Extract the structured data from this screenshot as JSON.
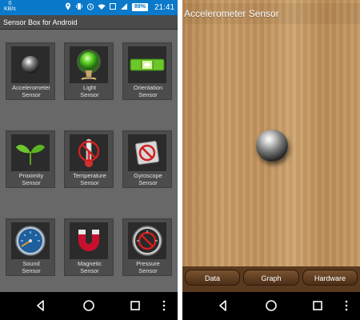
{
  "left_screen": {
    "status": {
      "data_rate_value": "0",
      "data_rate_unit": "KB/s",
      "battery": "89%",
      "time": "21:41"
    },
    "app_title": "Sensor Box for Android",
    "tiles": [
      {
        "label": "Accelerometer\nSensor",
        "icon": "metal-ball-icon"
      },
      {
        "label": "Light\nSensor",
        "icon": "green-bulb-icon"
      },
      {
        "label": "Orientation\nSensor",
        "icon": "level-icon"
      },
      {
        "label": "Proximity\nSensor",
        "icon": "sprout-icon"
      },
      {
        "label": "Temperature\nSensor",
        "icon": "thermometer-icon"
      },
      {
        "label": "Gyroscope\nSensor",
        "icon": "no-sign-icon"
      },
      {
        "label": "Sound\nSensor",
        "icon": "sound-gauge-icon"
      },
      {
        "label": "Magnetic\nSensor",
        "icon": "magnet-icon"
      },
      {
        "label": "Pressure\nSensor",
        "icon": "pressure-gauge-icon"
      }
    ]
  },
  "right_screen": {
    "title": "Accelerometer Sensor",
    "buttons": [
      "Data",
      "Graph",
      "Hardware"
    ]
  },
  "colors": {
    "status_bar": "#0a79c9",
    "grid_bg": "#686868",
    "wood": "#c1935f"
  }
}
